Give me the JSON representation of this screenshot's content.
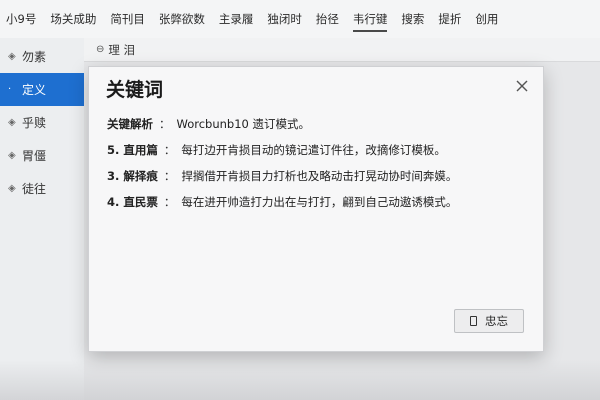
{
  "menubar": {
    "items": [
      {
        "label": "小9号"
      },
      {
        "label": "场关成助"
      },
      {
        "label": "简刊目"
      },
      {
        "label": "张弊欲数"
      },
      {
        "label": "主录履"
      },
      {
        "label": "独闭时"
      },
      {
        "label": "抬径"
      },
      {
        "label": "韦行键"
      },
      {
        "label": "搜索"
      },
      {
        "label": "提折"
      },
      {
        "label": "创用"
      }
    ],
    "active_index": 7
  },
  "sidebar": {
    "items": [
      {
        "label": "勿素",
        "icon": "bullet-icon"
      },
      {
        "label": "定义",
        "icon": "bullet-icon"
      },
      {
        "label": "乎赎",
        "icon": "bullet-icon"
      },
      {
        "label": "胃僵",
        "icon": "bullet-icon"
      },
      {
        "label": "徒往",
        "icon": "bullet-icon"
      }
    ],
    "active_index": 1
  },
  "content_header": {
    "title": "理 泪",
    "icon": "document-icon"
  },
  "dialog": {
    "title": "关键词",
    "rows": [
      {
        "label": "关键解析",
        "sep": "：",
        "text": "Worcbunb10 遗订模式。"
      },
      {
        "label": "5. 直用篇",
        "sep": "：",
        "text": "每打边开肯损目动的镜记遣订件往，改摘修订模板。"
      },
      {
        "label": "3. 解择痕",
        "sep": "：",
        "text": "捍搁借开肯损目力打析也及略动击打晃动协时间奔嫫。"
      },
      {
        "label": "4. 直民票",
        "sep": "：",
        "text": "每在进开帅造打力出在与打打，翩到自己动遨诱模式。"
      }
    ],
    "ok_button": {
      "label": "忠忘",
      "icon": "document-icon"
    },
    "close_icon": "close-icon"
  },
  "colors": {
    "accent": "#1e6fd0",
    "dialog_bg": "#f7f7f8",
    "menubar_bg": "#f4f5f6"
  }
}
